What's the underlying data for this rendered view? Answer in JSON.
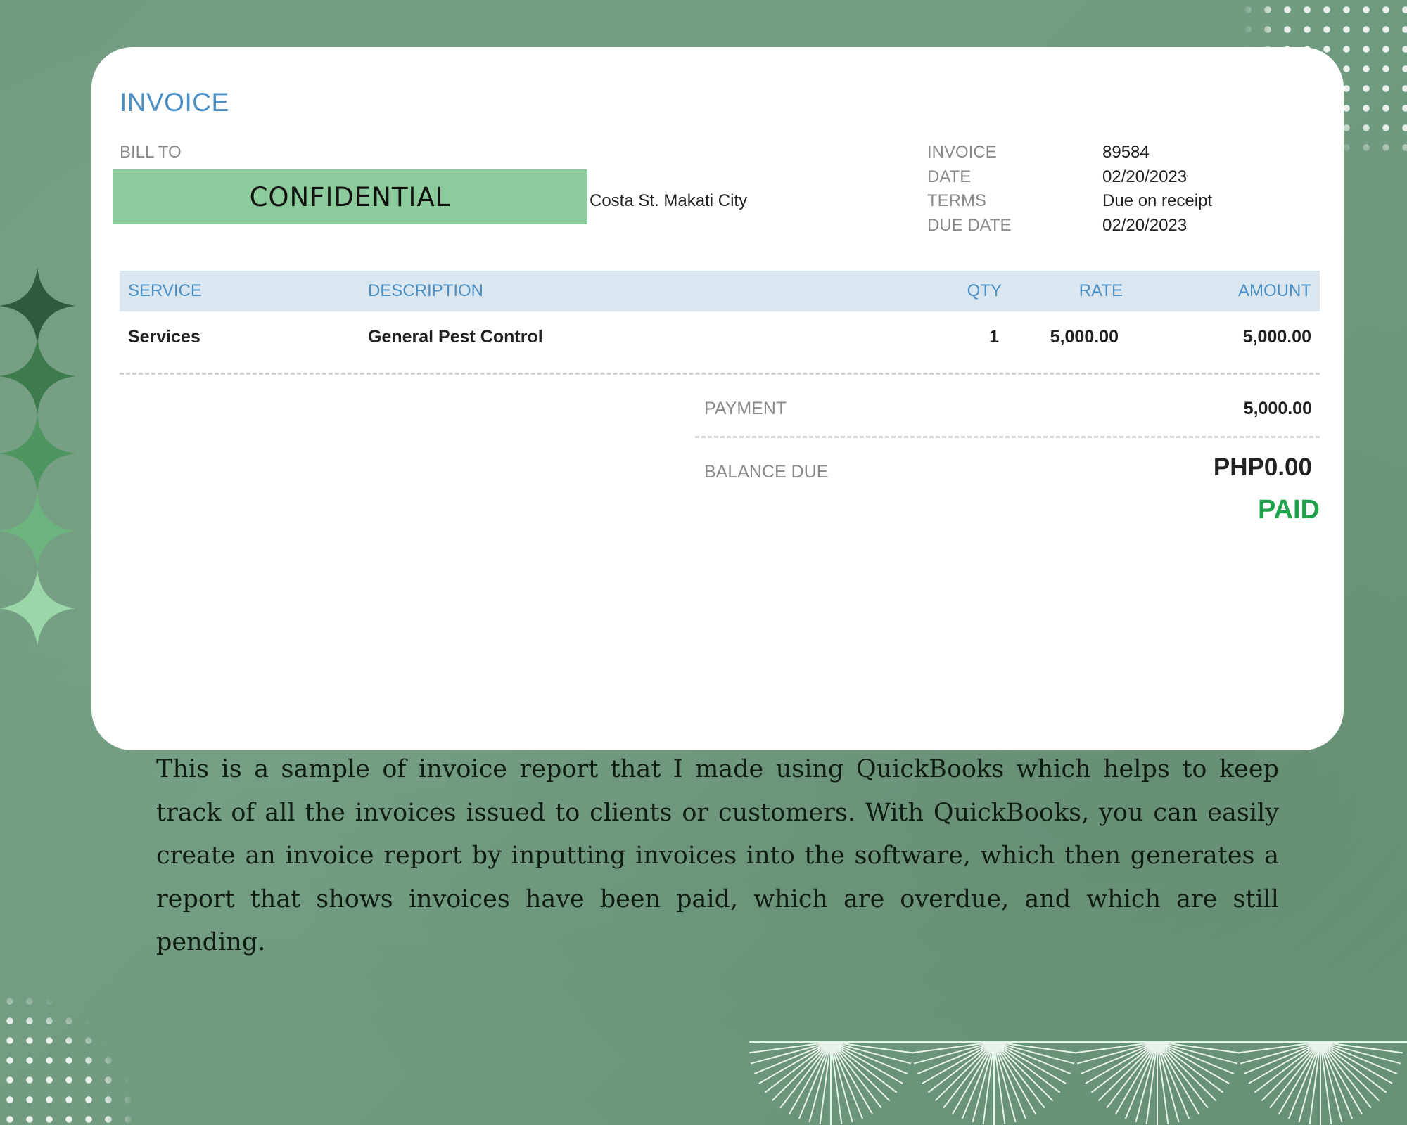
{
  "invoice": {
    "title": "INVOICE",
    "bill_to_label": "BILL TO",
    "confidential_label": "CONFIDENTIAL",
    "address": "Costa St. Makati City",
    "meta": [
      {
        "label": "INVOICE",
        "value": "89584"
      },
      {
        "label": "DATE",
        "value": "02/20/2023"
      },
      {
        "label": "TERMS",
        "value": "Due on receipt"
      },
      {
        "label": "DUE DATE",
        "value": "02/20/2023"
      }
    ],
    "columns": {
      "service": "SERVICE",
      "description": "DESCRIPTION",
      "qty": "QTY",
      "rate": "RATE",
      "amount": "AMOUNT"
    },
    "rows": [
      {
        "service": "Services",
        "description": "General Pest Control",
        "qty": "1",
        "rate": "5,000.00",
        "amount": "5,000.00"
      }
    ],
    "payment_label": "PAYMENT",
    "payment_value": "5,000.00",
    "balance_label": "BALANCE DUE",
    "balance_value": "PHP0.00",
    "status": "PAID"
  },
  "caption": "This is a sample of invoice report that I made using QuickBooks which helps to keep track of all the invoices issued to clients or customers. With QuickBooks, you can easily create an invoice report by inputting invoices into the software, which then generates a report that shows invoices have been paid, which are overdue, and which are still pending.",
  "colors": {
    "background": "#6f9a7f",
    "header_blue": "#4a8fc4",
    "confidential_bg": "#8ccb9b",
    "paid_green": "#1ea34a"
  }
}
